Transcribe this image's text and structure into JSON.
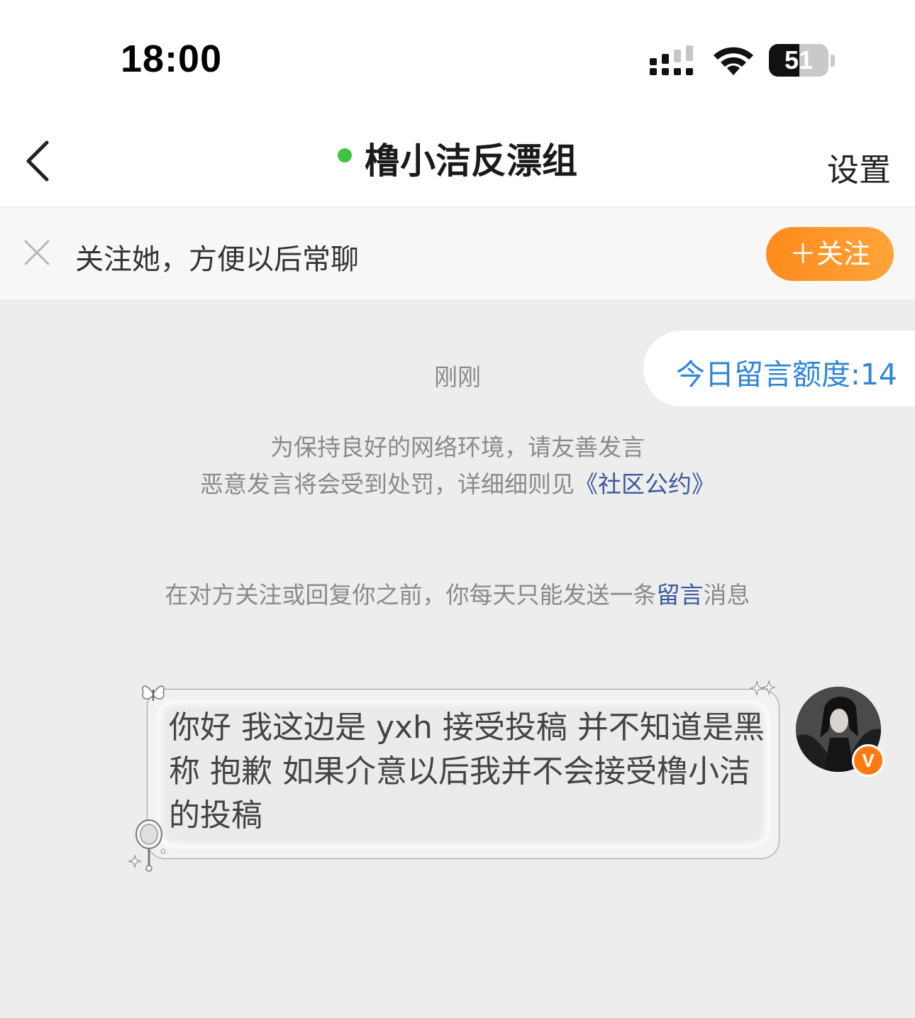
{
  "status_bar": {
    "time": "18:00",
    "battery_level": "51",
    "battery_fraction": 0.51,
    "signal_icon": "cellular-signal-icon",
    "wifi_icon": "wifi-icon"
  },
  "nav": {
    "back_icon": "chevron-left-icon",
    "title": "橹小洁反漂组",
    "online_color": "#3fc43f",
    "settings_label": "设置"
  },
  "follow_banner": {
    "close_icon": "close-icon",
    "hint": "关注她，方便以后常聊",
    "follow_button_label": "＋关注",
    "accent_color": "#ff8a1c"
  },
  "chat": {
    "quota_label": "今日留言额度:14",
    "timestamp": "刚刚",
    "notice_line1": "为保持良好的网络环境，请友善发言",
    "notice_line2_prefix": "恶意发言将会受到处罚，详细细则见",
    "notice_link": "《社区公约》",
    "limit_prefix": "在对方关注或回复你之前，你每天只能发送一条",
    "limit_link": "留言",
    "limit_suffix": "消息",
    "link_color": "#3a5a9a"
  },
  "message": {
    "text": "你好 我这边是 yxh 接受投稿 并不知道是黑称 抱歉 如果介意以后我并不会接受橹小洁的投稿",
    "sender": "self",
    "avatar_icon": "avatar-image",
    "verified_badge": "V",
    "badge_color": "#ff7a12"
  }
}
